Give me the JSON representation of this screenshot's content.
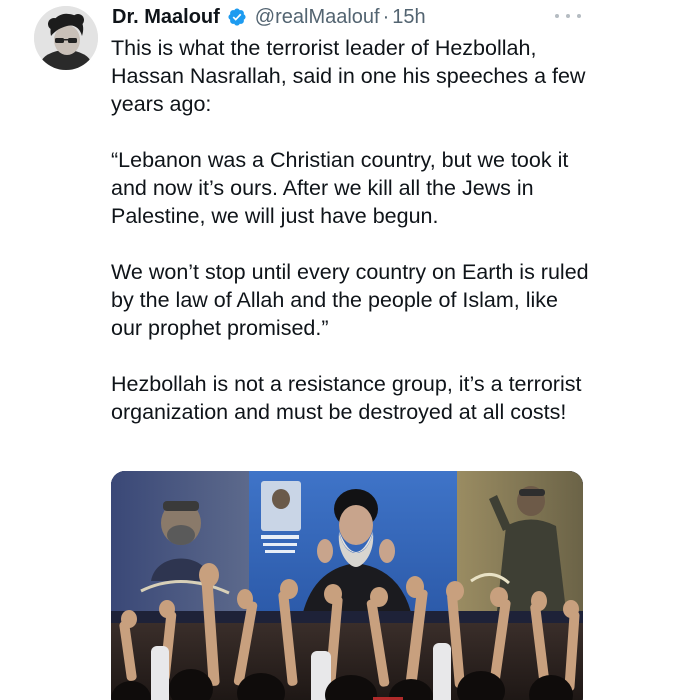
{
  "tweet": {
    "author": {
      "display_name": "Dr. Maalouf",
      "handle": "@realMaalouf",
      "verified": true,
      "verified_icon": "verified-badge-icon",
      "avatar_icon": "profile-avatar"
    },
    "separator": "·",
    "timestamp": "15h",
    "more_icon": "more-options-icon",
    "paragraphs": [
      "This is what the terrorist leader of Hezbollah, Hassan Nasrallah, said in one his speeches a few years ago:",
      "“Lebanon was a Christian country, but we took it and now it’s ours. After we kill all the Jews in Palestine, we will just have begun.",
      "We won’t stop until every country on Earth is ruled by the law of Allah and the people of Islam, like our prophet promised.”",
      "Hezbollah is not a resistance group, it’s a terrorist organization and must be destroyed at all costs!"
    ],
    "media": {
      "type": "photo",
      "description_icon": "rally-photo"
    }
  },
  "colors": {
    "text_primary": "#0f1419",
    "text_secondary": "#536471",
    "verified_blue": "#1d9bf0",
    "background": "#ffffff"
  }
}
